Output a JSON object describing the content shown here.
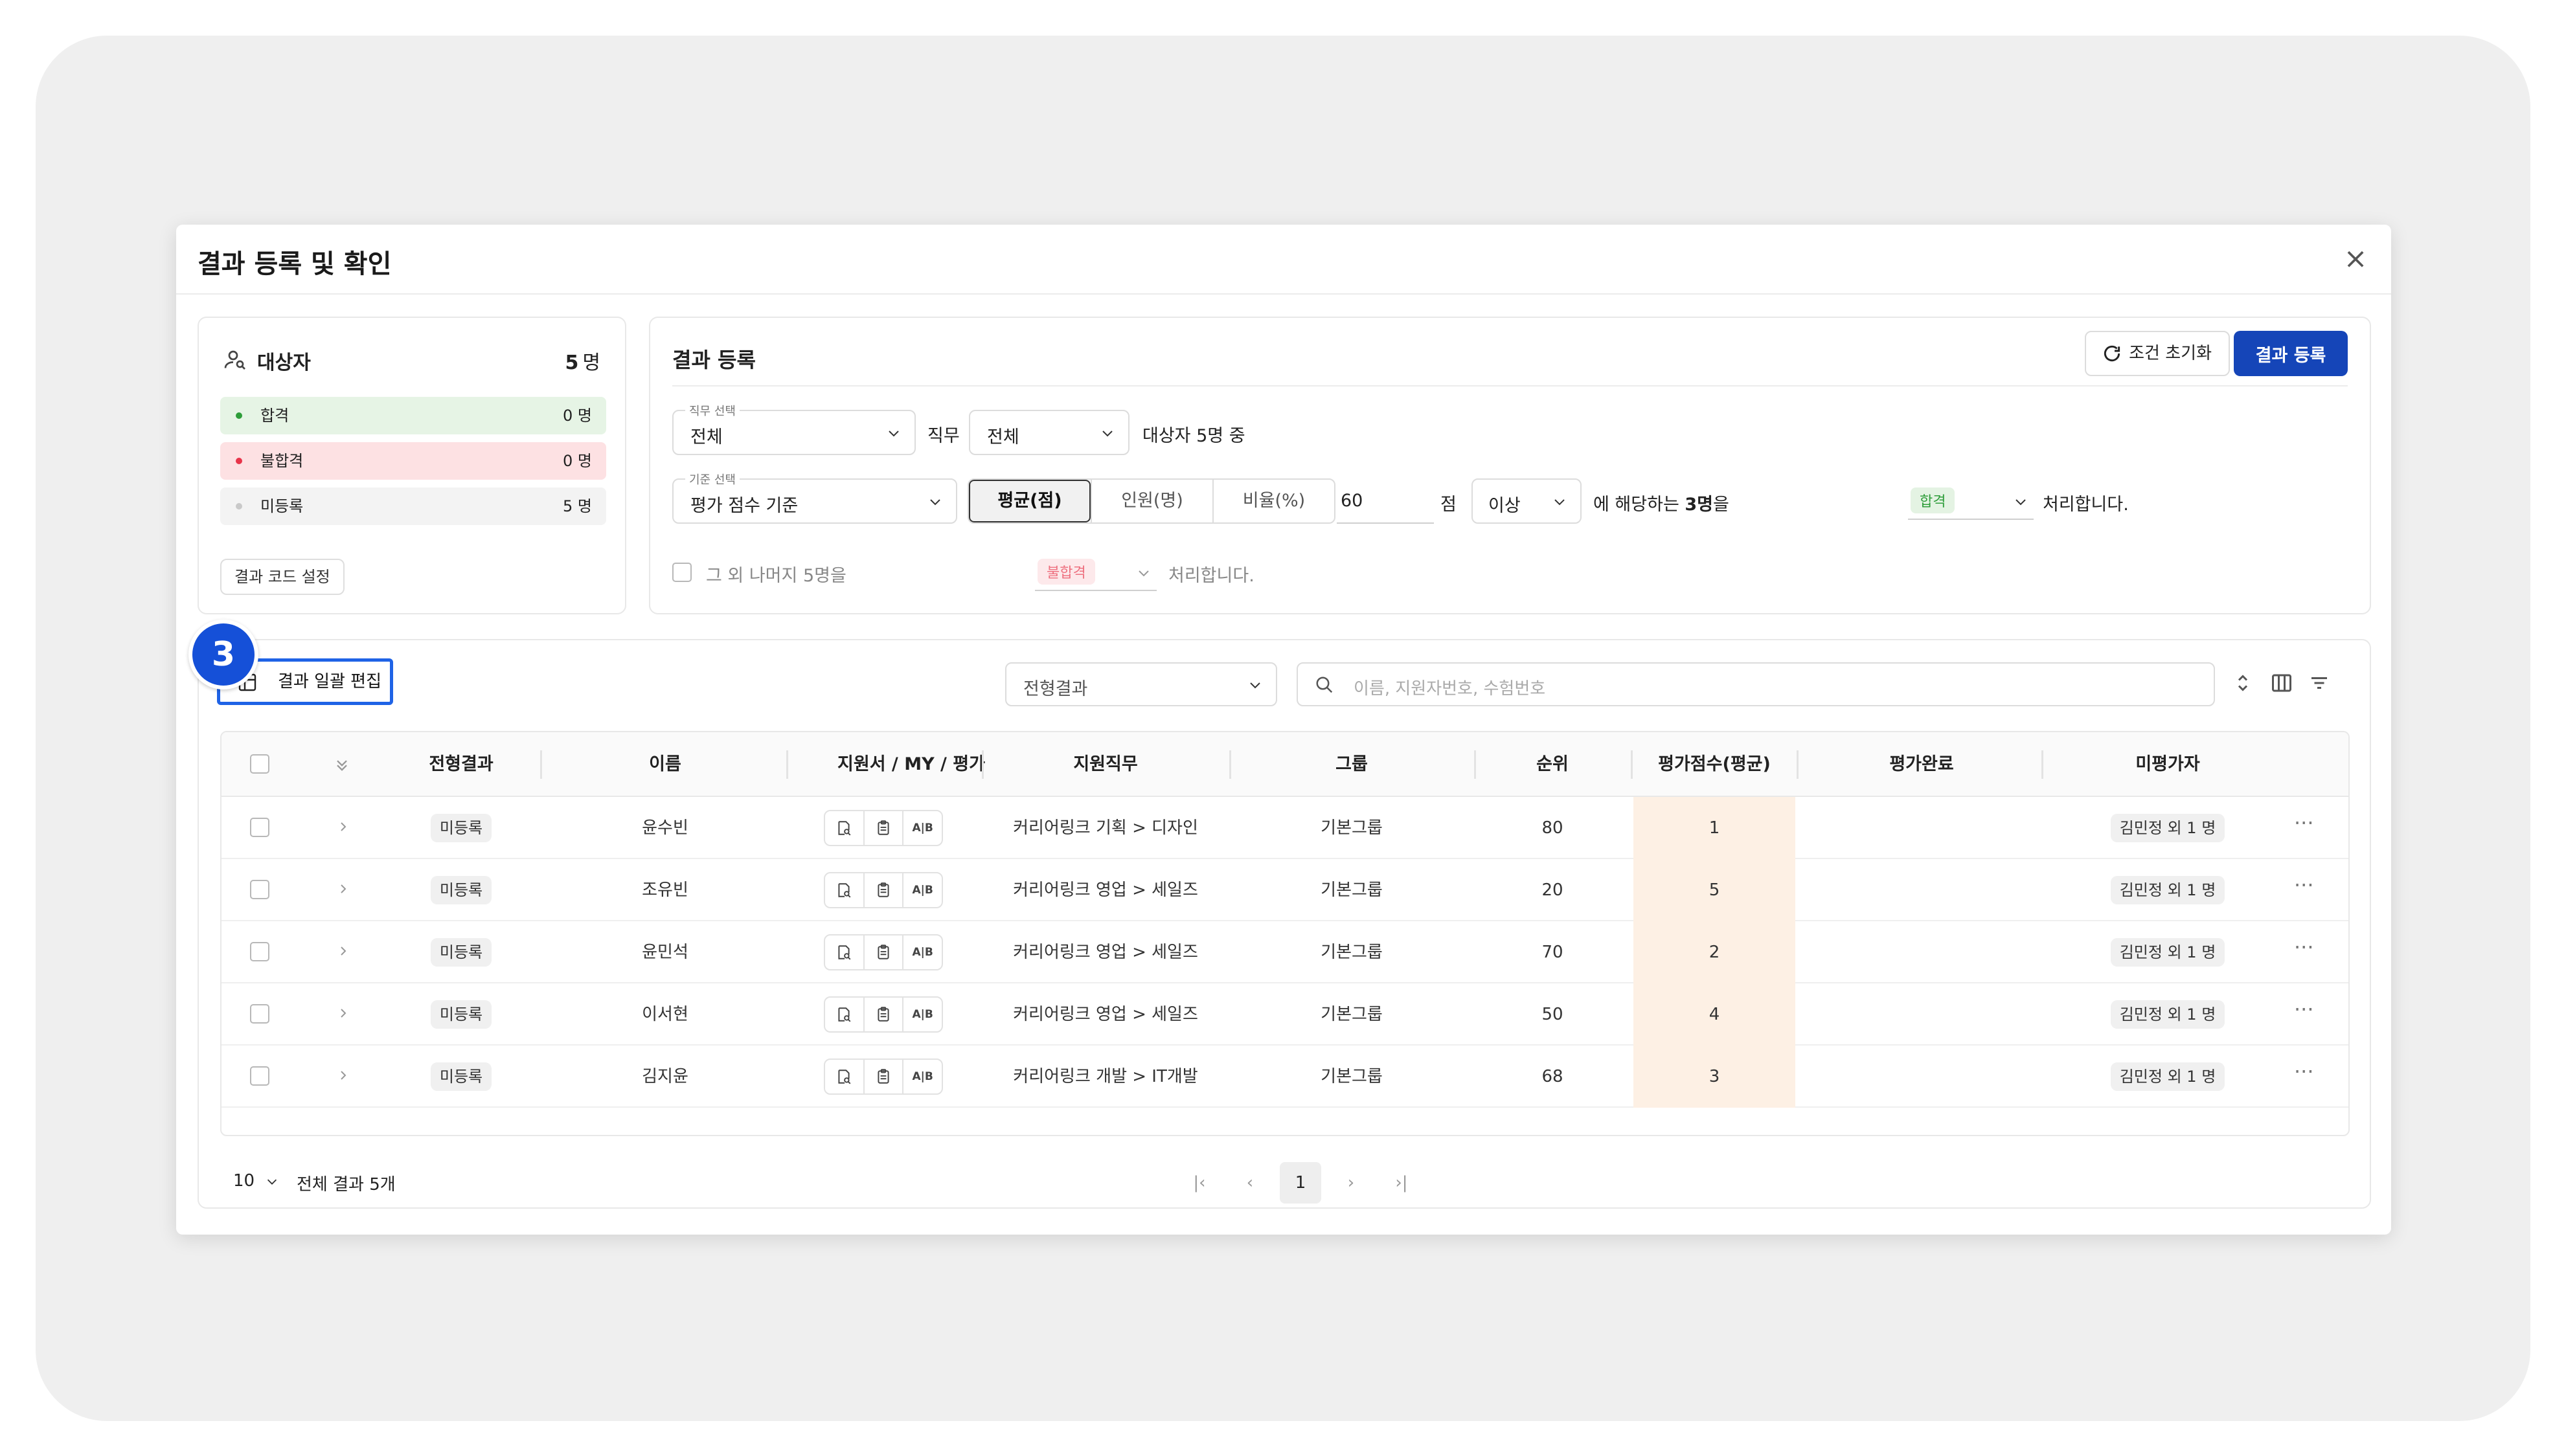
{
  "modal": {
    "title": "결과 등록 및 확인",
    "close": "×"
  },
  "summary": {
    "title": "대상자",
    "count_num": "5",
    "count_unit": "명",
    "stats": [
      {
        "label": "합격",
        "value": "0 명"
      },
      {
        "label": "불합격",
        "value": "0 명"
      },
      {
        "label": "미등록",
        "value": "5 명"
      }
    ],
    "code_button": "결과 코드 설정"
  },
  "register": {
    "title": "결과 등록",
    "reset_button": "조건 초기화",
    "submit_button": "결과 등록",
    "job_select": {
      "label": "직무 선택",
      "value": "전체"
    },
    "job_text": "직무",
    "job_value": "전체",
    "target_text": "대상자 5명 중",
    "criteria_select": {
      "label": "기준 선택",
      "value": "평가 점수 기준"
    },
    "segments": [
      "평균(점)",
      "인원(명)",
      "비율(%)"
    ],
    "score_value": "60",
    "score_unit": "점",
    "compare_value": "이상",
    "match_text_pre": "에 해당하는 ",
    "match_text_bold": "3명",
    "match_text_post": "을",
    "pass_pill": "합격",
    "process_text": "처리합니다.",
    "rest_text": "그 외 나머지 5명을",
    "fail_pill": "불합격",
    "rest_process_text": "처리합니다."
  },
  "table_section": {
    "step_number": "3",
    "bulk_edit_button": "결과 일괄 편집",
    "filter_select": "전형결과",
    "search_placeholder": "이름, 지원자번호, 수험번호",
    "columns": [
      "전형결과",
      "이름",
      "지원서 / MY / 평가",
      "지원직무",
      "그룹",
      "순위",
      "평가점수(평균)",
      "평가완료",
      "미평가자"
    ],
    "rows": [
      {
        "status": "미등록",
        "name": "윤수빈",
        "job": "커리어링크 기획 > 디자인",
        "group": "기본그룹",
        "rank": "80",
        "score": "1",
        "done": "",
        "pending": "김민정 외 1 명"
      },
      {
        "status": "미등록",
        "name": "조유빈",
        "job": "커리어링크 영업 > 세일즈",
        "group": "기본그룹",
        "rank": "20",
        "score": "5",
        "done": "",
        "pending": "김민정 외 1 명"
      },
      {
        "status": "미등록",
        "name": "윤민석",
        "job": "커리어링크 영업 > 세일즈",
        "group": "기본그룹",
        "rank": "70",
        "score": "2",
        "done": "",
        "pending": "김민정 외 1 명"
      },
      {
        "status": "미등록",
        "name": "이서현",
        "job": "커리어링크 영업 > 세일즈",
        "group": "기본그룹",
        "rank": "50",
        "score": "4",
        "done": "",
        "pending": "김민정 외 1 명"
      },
      {
        "status": "미등록",
        "name": "김지윤",
        "job": "커리어링크 개발 > IT개발",
        "group": "기본그룹",
        "rank": "68",
        "score": "3",
        "done": "",
        "pending": "김민정 외 1 명"
      }
    ],
    "ab_label": "A|B",
    "more_label": "···"
  },
  "footer": {
    "page_size": "10",
    "total_text": "전체 결과 5개",
    "current_page": "1"
  },
  "colors": {
    "primary": "#1545b8",
    "highlight": "#1f63e6",
    "pass": "#2e9d3a",
    "fail": "#e8344a",
    "score_bg": "#fdf0e4"
  }
}
